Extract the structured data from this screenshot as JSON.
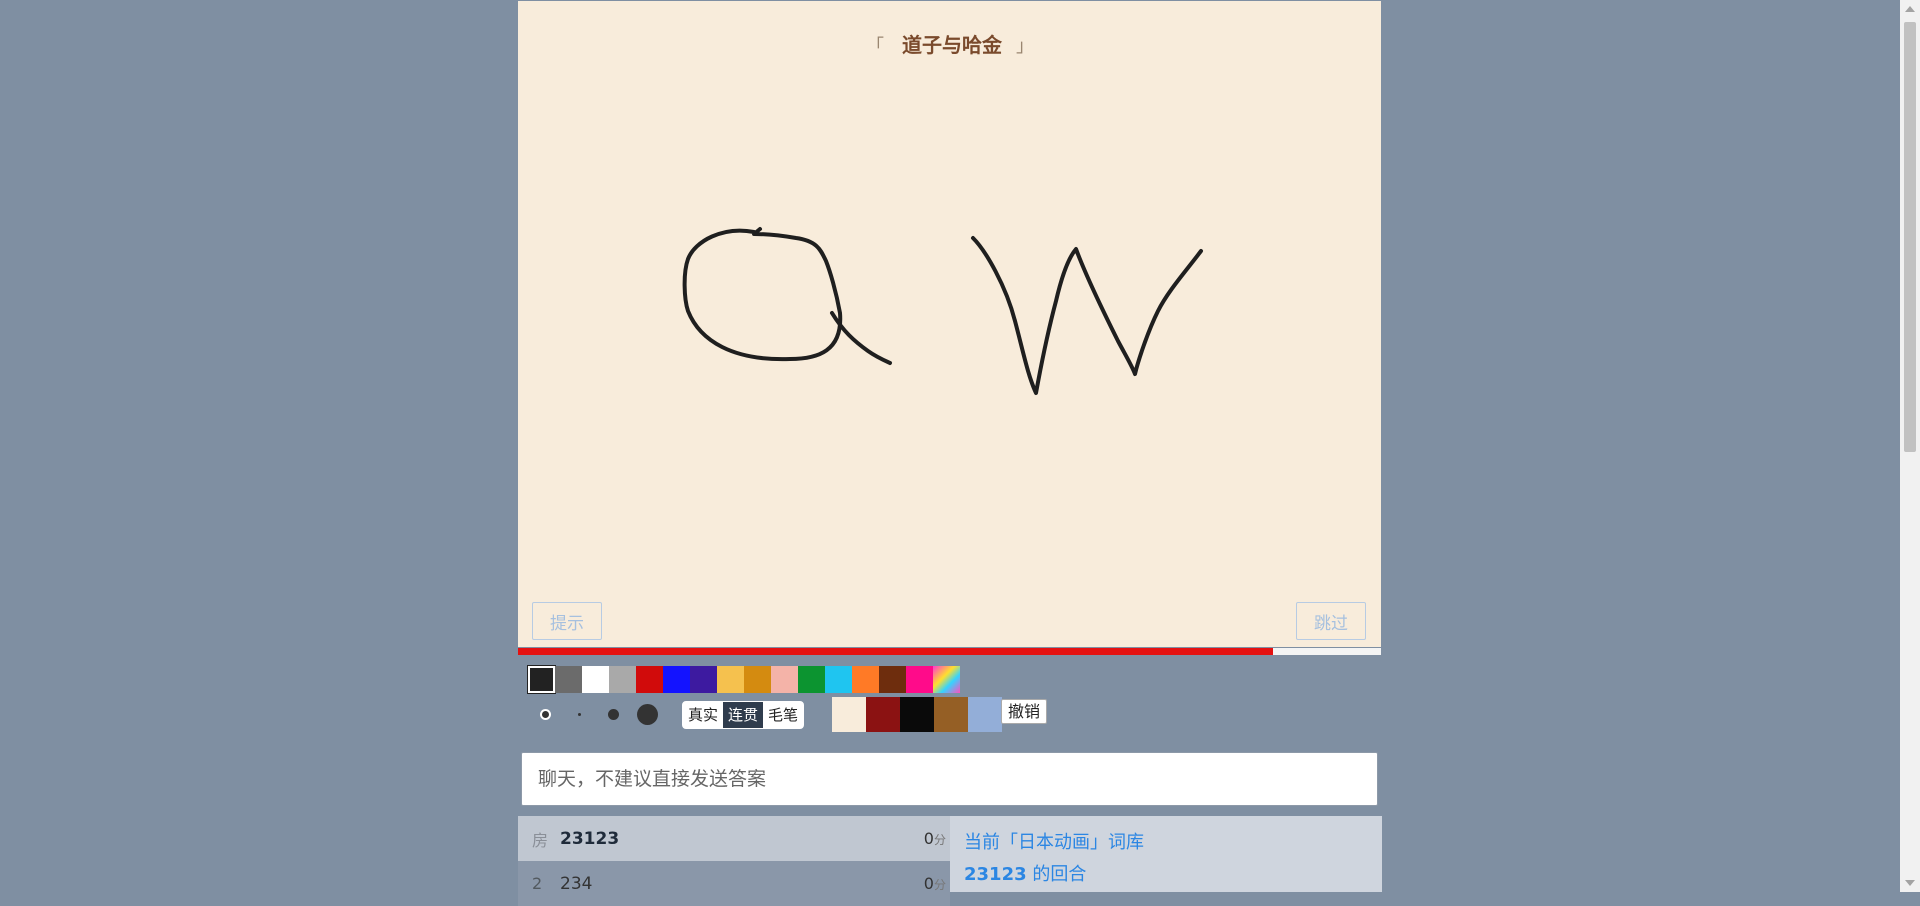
{
  "title": {
    "open_bracket": "「",
    "word": "道子与哈金",
    "close_bracket": "」"
  },
  "buttons": {
    "hint": "提示",
    "skip": "跳过",
    "undo": "撤销"
  },
  "progress": {
    "fraction_remaining": 0.875,
    "color": "#e41111"
  },
  "palette": {
    "selected_index": 0,
    "colors": [
      "#222222",
      "#6b6b6b",
      "#ffffff",
      "#a9a9a9",
      "#d10b0b",
      "#1313ff",
      "#3d1aa0",
      "#f5c14e",
      "#d48b10",
      "#f4b3a8",
      "#0c9430",
      "#1fc5f0",
      "#ff7a26",
      "#6e2d0d",
      "#ff0b8a",
      "rainbow"
    ]
  },
  "brush_sizes": {
    "selected_index": 0,
    "names": [
      "brush-size-small-icon",
      "brush-size-tiny-icon",
      "brush-size-medium-icon",
      "brush-size-large-icon"
    ]
  },
  "modes": {
    "items": [
      "真实",
      "连贯",
      "毛笔"
    ],
    "active_index": 1
  },
  "background_colors": [
    "#f8ecdb",
    "#8b1212",
    "#0a0a0a",
    "#955f25",
    "#93aed8"
  ],
  "chat": {
    "placeholder": "聊天，不建议直接发送答案"
  },
  "players": [
    {
      "rank": "房",
      "name": "23123",
      "score": "0",
      "unit": "分"
    },
    {
      "rank": "2",
      "name": "234",
      "score": "0",
      "unit": "分"
    }
  ],
  "info": {
    "line1": "当前「日本动画」词库",
    "line2_name": "23123",
    "line2_suffix": " 的回合"
  }
}
